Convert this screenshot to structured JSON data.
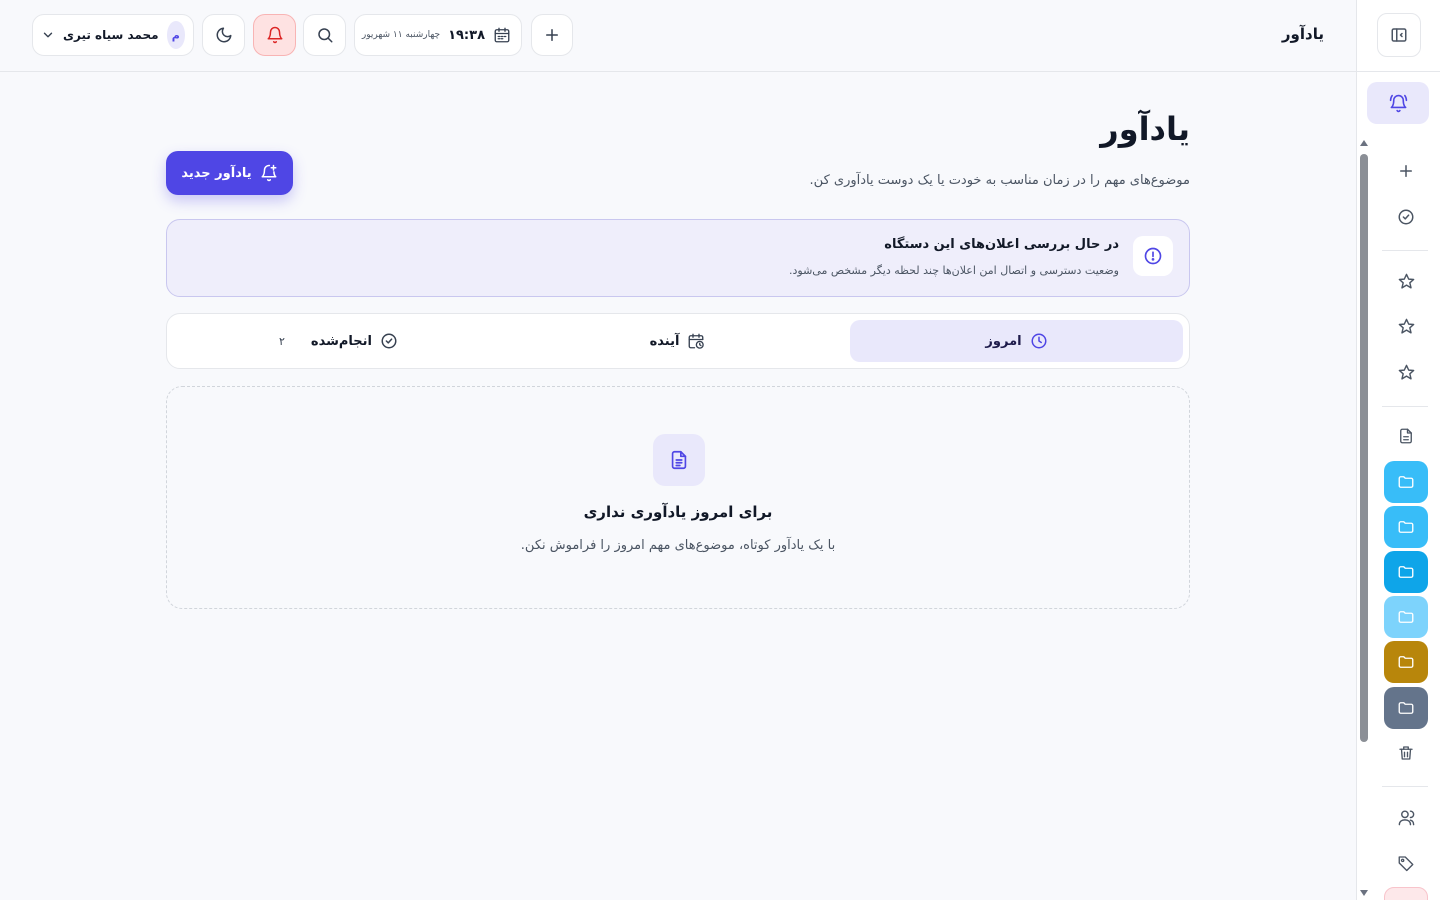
{
  "header": {
    "app_title": "یادآور",
    "user": {
      "name": "محمد سیاه تیری",
      "initial": "م"
    },
    "date": {
      "time": "۱۹:۳۸",
      "day": "چهارشنبه ۱۱ شهریور"
    }
  },
  "page": {
    "title": "یادآور",
    "subtitle": "موضوع‌های مهم را در زمان مناسب به خودت یا یک دوست یادآوری کن.",
    "new_button": "یادآور جدید"
  },
  "notice": {
    "title": "در حال بررسی اعلان‌های این دستگاه",
    "description": "وضعیت دسترسی و اتصال امن اعلان‌ها چند لحظه دیگر مشخص می‌شود."
  },
  "tabs": [
    {
      "label": "امروز",
      "icon": "clock-icon",
      "active": true
    },
    {
      "label": "آینده",
      "icon": "calendar-clock-icon",
      "active": false
    },
    {
      "label": "انجام‌شده",
      "icon": "check-circle-icon",
      "active": false,
      "count": "۲"
    }
  ],
  "empty_state": {
    "title": "برای امروز یادآوری نداری",
    "description": "با یک یادآور کوتاه، موضوع‌های مهم امروز را فراموش نکن."
  },
  "sidebar": {
    "folders": [
      {
        "color": "#38bdf8"
      },
      {
        "color": "#38bdf8"
      },
      {
        "color": "#0ea5e9"
      },
      {
        "color": "#7dd3fc"
      },
      {
        "color": "#b8860b"
      },
      {
        "color": "#64748b"
      }
    ]
  },
  "colors": {
    "accent": "#4f46e5",
    "accent_soft": "#e9e8fb",
    "danger_soft": "#fee2e2",
    "danger": "#dc2626"
  }
}
